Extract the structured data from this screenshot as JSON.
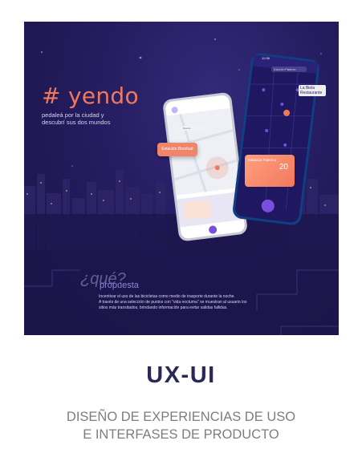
{
  "brand": {
    "title": "# yendo",
    "tagline_1": "pedaleá por la ciudad y",
    "tagline_2": "descubrí sus dos mundos"
  },
  "phone_front": {
    "statusbar_time": "12:30",
    "search_placeholder": "Buscar...",
    "map_bubble": "Estación Borxhad"
  },
  "phone_back": {
    "statusbar_time": "12:30",
    "search_placeholder": "Estación Palermo",
    "location_tag": {
      "line1": "La Biela",
      "line2": "Restaurante"
    },
    "station_card": {
      "title": "Estación Palermo",
      "count": "20"
    }
  },
  "proposal": {
    "heading_1": "¿qué?",
    "heading_2": "propuesta",
    "line_1": "Incentivar el uso de las bicicletas como medio de trasporte durante la noche.",
    "line_2": "A través de una selección de puntos con \"vida nocturna\" se muestran al usuario los",
    "line_3": "sitios más transitados, brindando información para evitar salidas fallidas."
  },
  "caption": {
    "title": "UX-UI",
    "subtitle_1": "DISEÑO DE EXPERIENCIAS DE USO",
    "subtitle_2": "E INTERFASES DE PRODUCTO"
  },
  "colors": {
    "background_dark": "#1f1853",
    "accent_coral": "#f2785c",
    "accent_purple": "#7a4fe0",
    "caption_title": "#2b2857",
    "caption_subtitle": "#7d7d80"
  }
}
